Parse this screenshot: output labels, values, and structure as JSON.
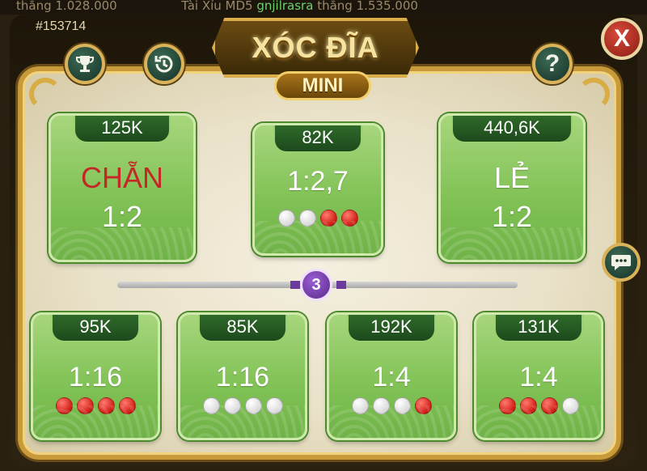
{
  "ticker": {
    "text_1": "thắng  1.028.000",
    "text_2": "Tài Xỉu MD5 ",
    "name": "gnjilrasra",
    "text_3": " thắng  1.535.000"
  },
  "session_id": "#153714",
  "title": "XÓC ĐĨA",
  "subtitle": "MINI",
  "buttons": {
    "close": "X",
    "help": "?"
  },
  "slider": {
    "value": "3"
  },
  "colors": {
    "panel_green": "#7fc154",
    "tab_dark_green": "#1d4a1c",
    "gold": "#d9b25a",
    "red_text": "#c42826",
    "knob_purple": "#5a2a8a"
  },
  "top_panels": [
    {
      "amount": "125K",
      "label": "CHẴN",
      "ratio": "1:2"
    },
    {
      "amount": "82K",
      "ratio": "1:2,7",
      "dots": [
        "white",
        "white",
        "red",
        "red"
      ]
    },
    {
      "amount": "440,6K",
      "label": "LẺ",
      "ratio": "1:2"
    }
  ],
  "bottom_panels": [
    {
      "amount": "95K",
      "ratio": "1:16",
      "dots": [
        "red",
        "red",
        "red",
        "red"
      ]
    },
    {
      "amount": "85K",
      "ratio": "1:16",
      "dots": [
        "white",
        "white",
        "white",
        "white"
      ]
    },
    {
      "amount": "192K",
      "ratio": "1:4",
      "dots": [
        "white",
        "white",
        "white",
        "red"
      ]
    },
    {
      "amount": "131K",
      "ratio": "1:4",
      "dots": [
        "red",
        "red",
        "red",
        "white"
      ]
    }
  ]
}
